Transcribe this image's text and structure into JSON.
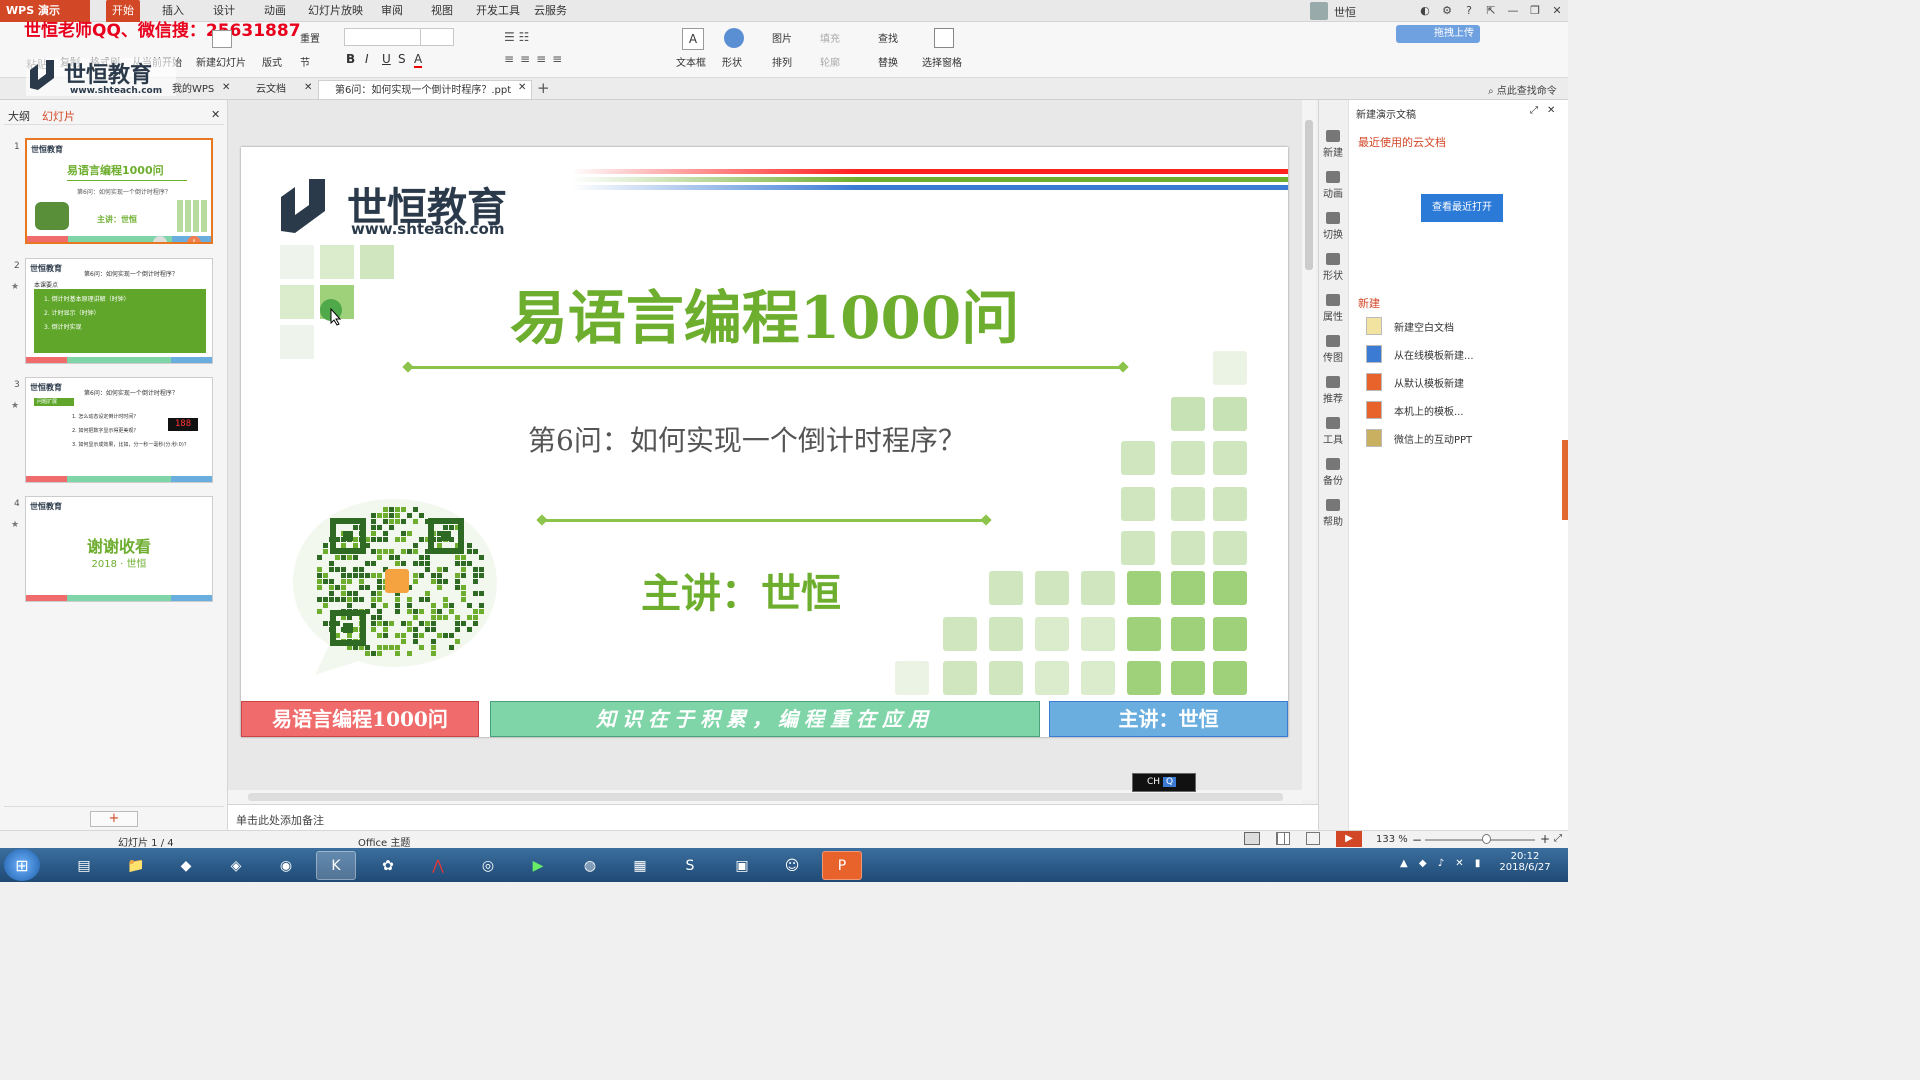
{
  "app": {
    "name": "WPS 演示",
    "menu_tabs": [
      "开始",
      "插入",
      "设计",
      "动画",
      "幻灯片放映",
      "审阅",
      "视图",
      "开发工具",
      "云服务"
    ],
    "active_tab": "开始",
    "user": "世恒",
    "upload_label": "拖拽上传"
  },
  "watermark": "世恒老师QQ、微信搜：25631887",
  "ribbon": {
    "paste": "粘贴",
    "copy": "复制",
    "format_painter": "格式刷",
    "from_start": "从当前开始",
    "new_slide": "新建幻灯片",
    "layout": "版式",
    "reset": "重置",
    "section": "节",
    "textbox": "文本框",
    "shapes": "形状",
    "picture": "图片",
    "fill": "填充",
    "arrange": "排列",
    "outline": "轮廓",
    "find": "查找",
    "replace": "替换",
    "select_pane": "选择窗格"
  },
  "doc_tabs": [
    "我的WPS",
    "云文档",
    "第6问：如何实现一个倒计时程序？.ppt"
  ],
  "doc_search": "点此查找命令",
  "left_pane": {
    "tabs": [
      "大纲",
      "幻灯片"
    ],
    "thumbs": [
      {
        "num": "1",
        "title": "易语言编程1000问",
        "sub": "第6问：如何实现一个倒计时程序？",
        "speaker": "主讲：世恒"
      },
      {
        "num": "2",
        "title": "第6问：如何实现一个倒计时程序？",
        "heading": "本课要点",
        "items": [
          "1. 倒计时基本原理讲解（时钟）",
          "2. 计时显示（时钟）",
          "3. 倒计时实现"
        ]
      },
      {
        "num": "3",
        "title": "第6问：如何实现一个倒计时程序？",
        "heading": "问题扩展",
        "items": [
          "1. 怎么动态设定倒计时时间？",
          "2. 如何把数字显示得更美观？",
          "3. 如何显示成效果，比如，分一秒一毫秒(分:秒:0)？"
        ],
        "led": "188"
      },
      {
        "num": "4",
        "title": "谢谢收看",
        "sub": "2018 · 世恒"
      }
    ]
  },
  "slide": {
    "logo_text": "世恒教育",
    "logo_url": "www.shteach.com",
    "title": "易语言编程1000问",
    "question": "第6问：如何实现一个倒计时程序？",
    "speaker": "主讲：世恒",
    "footer_left": "易语言编程1000问",
    "footer_mid": "知识在于积累，编程重在应用",
    "footer_right": "主讲：世恒"
  },
  "notes_placeholder": "单击此处添加备注",
  "right_bar": [
    "新建",
    "动画",
    "切换",
    "形状",
    "属性",
    "传图",
    "推荐",
    "工具",
    "备份",
    "帮助"
  ],
  "task_pane": {
    "title": "新建演示文稿",
    "recent": "最近使用的云文档",
    "open_recent": "查看最近打开",
    "new_heading": "新建",
    "new_items": [
      "新建空白文档",
      "从在线模板新建...",
      "从默认模板新建",
      "本机上的模板...",
      "微信上的互动PPT"
    ]
  },
  "status": {
    "slide_pos": "幻灯片 1 / 4",
    "theme": "Office 主题",
    "zoom": "133 %"
  },
  "ime": "CH",
  "clock": {
    "time": "20:12",
    "date": "2018/6/27"
  },
  "colors": {
    "accent": "#d24726",
    "slide_green": "#6dae2e",
    "footer_red": "#f06b6b",
    "footer_teal": "#7fd4a8",
    "footer_blue": "#6aaee0"
  }
}
